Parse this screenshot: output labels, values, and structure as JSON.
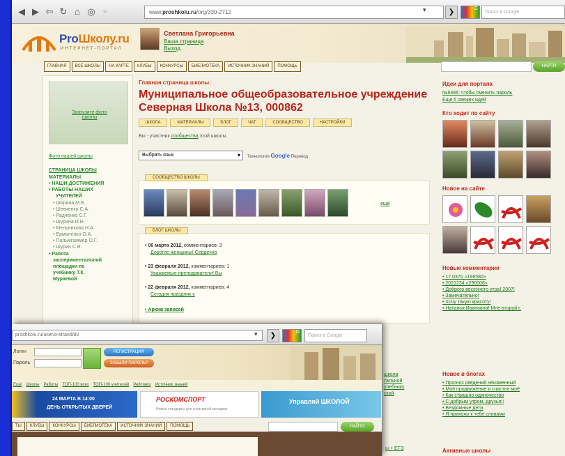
{
  "browser": {
    "url_prefix": "www.",
    "url_domain": "proshkolu.ru",
    "url_path": "/org/330-2712",
    "search_placeholder": "Поиск в Google",
    "google_badge": "G"
  },
  "header": {
    "brand_main": "Pro",
    "brand_accent": "Школу.ru",
    "brand_sub": "ИНТЕРНЕТ-ПОРТАЛ",
    "user_name": "Светлана Григорьевна",
    "user_link1": "Ваша страница",
    "user_link2": "Выход"
  },
  "menu": [
    "ГЛАВНАЯ",
    "ВСЕ ШКОЛЫ",
    "НА КАРТЕ",
    "КЛУБЫ",
    "КОНКУРСЫ",
    "БИБЛИОТЕКА",
    "ИСТОЧНИК ЗНАНИЙ",
    "ПОМОЩЬ"
  ],
  "right_search": {
    "button": "НАЙТИ"
  },
  "left": {
    "photo_link": "Загрузите фото школы",
    "school_photo_link": "Фото нашей школы",
    "nav": [
      {
        "t": "СТРАНИЦА ШКОЛЫ",
        "s": "u"
      },
      {
        "t": "МАТЕРИАЛЫ",
        "s": "b"
      },
      {
        "t": "• НАШИ ДОСТИЖЕНИЯ",
        "s": "b"
      },
      {
        "t": "• РАБОТЫ НАШИХ",
        "s": "b"
      },
      {
        "t": "УЧИТЕЛЕЙ",
        "s": "b"
      },
      {
        "t": "• Ширина М.Б.",
        "s": "t"
      },
      {
        "t": "• Шевченко С.А.",
        "s": "t"
      },
      {
        "t": "• Радченко С.Г.",
        "s": "t"
      },
      {
        "t": "• Шурина И.Н.",
        "s": "t"
      },
      {
        "t": "• Мельникова Н.А.",
        "s": "t"
      },
      {
        "t": "• Ермоленко О.А.",
        "s": "t"
      },
      {
        "t": "• Пальмгаммер О.Г.",
        "s": "t"
      },
      {
        "t": "• Шурин С.В.",
        "s": "t"
      },
      {
        "t": "• Работа",
        "s": "b"
      },
      {
        "t": "экспериментальной",
        "s": "b"
      },
      {
        "t": "площадки по",
        "s": "b"
      },
      {
        "t": "учебнику Т.К.",
        "s": "b"
      },
      {
        "t": "Мураевой",
        "s": "b"
      }
    ]
  },
  "main": {
    "crumb": "Главная страница школы:",
    "title": "Муниципальное общеобразовательное учреждение Северная Школа №13, 000862",
    "tabs": [
      "ШКОЛА",
      "МАТЕРИАЛЫ",
      "БЛОГ",
      "ЧАТ",
      "СООБЩЕСТВО",
      "НАСТРОЙКИ"
    ],
    "member_pre": "Вы - участник ",
    "member_link": "сообщества",
    "member_post": " этой школы.",
    "lang_select": "Выбрать язык",
    "powered": "Технологии",
    "google": "Google",
    "translate": "Перевод",
    "community_tab": "СООБЩЕСТВО ШКОЛЫ",
    "more": "ещё",
    "blog_tab": "БЛОГ ШКОЛЫ",
    "blog": [
      {
        "date": "• 06 марта 2012,",
        "meta": " комментариев: 3",
        "title": "Дорогие женщины! Сердечно"
      },
      {
        "date": "• 23 февраля 2012,",
        "meta": " комментариев: 1",
        "title": "Уважаемые преподаватели! Вы"
      },
      {
        "date": "• 22 февраля 2012,",
        "meta": " комментариев: 4",
        "title": "Сегодня праздник у"
      }
    ],
    "archive": "• Архив записей"
  },
  "right": {
    "ideas_h": "Идеи для портала",
    "ideas1": "№6486: чтобы сменить пароль",
    "ideas2": "Еще 5 свежих идей",
    "who_h": "Кто ходит по сайту",
    "new_h": "Новое на сайте",
    "comments_h": "Новые комментарии",
    "comments": [
      "• 17.0370 «196580»",
      "• 2021234 «290008»",
      "• Доброго весеннего утра! 2007!",
      "• Замечательно!",
      "• Хочу такую красоту!",
      "• Наталья Ивановна! Мне второй г."
    ],
    "blogs_h": "Новое в блогах",
    "blogs": [
      "• Прогноз сведений неизменный",
      "• Моё продвижение и счастье моё",
      "• Как страшно одиночество",
      "• С добрым утром, друзья!!",
      "• Бездомные дети",
      "• Я прихожу к тебе словами"
    ],
    "active_h": "Активные школы"
  },
  "overlay": {
    "url": "proshkolu.ru/user/o-strand/80",
    "login": "Логин",
    "pass": "Пароль",
    "reg": "РЕГИСТРАЦИЯ",
    "forgot": "ЗАБЫЛИ ПАРОЛЬ?",
    "nav": [
      "Ещё",
      "Школы",
      "Работы",
      "ТОП-100 всех",
      "ТОП-100 учителей",
      "Рейтинги",
      "Источник знаний"
    ],
    "banner1a": "24 МАРТА В 14:00",
    "banner1b": "ДЕНЬ ОТКРЫТЫХ ДВЕРЕЙ",
    "banner2": "РОСКОМСПОРТ",
    "banner2sub": "Новые стандарты для спортивной методики",
    "banner3": "Управляй ШКОЛОЙ",
    "menu": [
      "ТЫ",
      "КЛУБЫ",
      "КОНКУРСЫ",
      "БИБЛИОТЕКА",
      "ИСТОЧНИК ЗНАНИЙ",
      "ПОМОЩЬ"
    ],
    "go": "НАЙТИ",
    "side": [
      "школа",
      "тальной",
      "учебнику",
      "ской"
    ],
    "nfv": "ы + ЕГЭ"
  }
}
